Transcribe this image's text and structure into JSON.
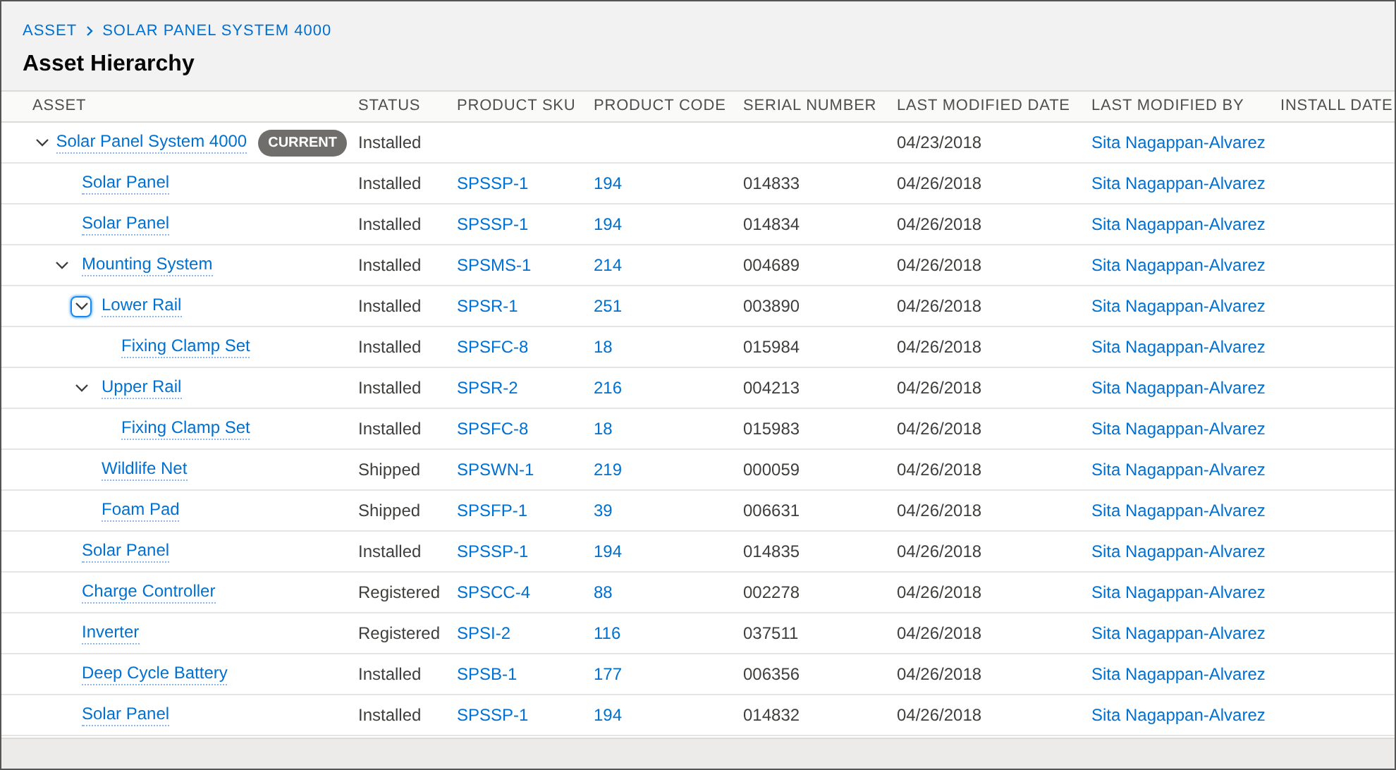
{
  "breadcrumb": [
    {
      "label": "ASSET"
    },
    {
      "label": "SOLAR PANEL SYSTEM 4000"
    }
  ],
  "title": "Asset Hierarchy",
  "table": {
    "columns": [
      "ASSET",
      "STATUS",
      "PRODUCT SKU",
      "PRODUCT CODE",
      "SERIAL NUMBER",
      "LAST MODIFIED DATE",
      "LAST MODIFIED BY",
      "INSTALL DATE"
    ],
    "rows": [
      {
        "name": "Solar Panel System 4000",
        "badge": "CURRENT",
        "status": "Installed",
        "sku": "",
        "code": "",
        "serial": "",
        "modified": "04/23/2018",
        "modified_by": "Sita Nagappan-Alvarez",
        "expanded": true,
        "focused": false,
        "children": [
          {
            "name": "Solar Panel",
            "status": "Installed",
            "sku": "SPSSP-1",
            "code": "194",
            "serial": "014833",
            "modified": "04/26/2018",
            "modified_by": "Sita Nagappan-Alvarez"
          },
          {
            "name": "Solar Panel",
            "status": "Installed",
            "sku": "SPSSP-1",
            "code": "194",
            "serial": "014834",
            "modified": "04/26/2018",
            "modified_by": "Sita Nagappan-Alvarez"
          },
          {
            "name": "Mounting System",
            "status": "Installed",
            "sku": "SPSMS-1",
            "code": "214",
            "serial": "004689",
            "modified": "04/26/2018",
            "modified_by": "Sita Nagappan-Alvarez",
            "expanded": true,
            "focused": false,
            "children": [
              {
                "name": "Lower Rail",
                "status": "Installed",
                "sku": "SPSR-1",
                "code": "251",
                "serial": "003890",
                "modified": "04/26/2018",
                "modified_by": "Sita Nagappan-Alvarez",
                "expanded": true,
                "focused": true,
                "children": [
                  {
                    "name": "Fixing Clamp Set",
                    "status": "Installed",
                    "sku": "SPSFC-8",
                    "code": "18",
                    "serial": "015984",
                    "modified": "04/26/2018",
                    "modified_by": "Sita Nagappan-Alvarez"
                  }
                ]
              },
              {
                "name": "Upper Rail",
                "status": "Installed",
                "sku": "SPSR-2",
                "code": "216",
                "serial": "004213",
                "modified": "04/26/2018",
                "modified_by": "Sita Nagappan-Alvarez",
                "expanded": true,
                "focused": false,
                "children": [
                  {
                    "name": "Fixing Clamp Set",
                    "status": "Installed",
                    "sku": "SPSFC-8",
                    "code": "18",
                    "serial": "015983",
                    "modified": "04/26/2018",
                    "modified_by": "Sita Nagappan-Alvarez"
                  }
                ]
              },
              {
                "name": "Wildlife Net",
                "status": "Shipped",
                "sku": "SPSWN-1",
                "code": "219",
                "serial": "000059",
                "modified": "04/26/2018",
                "modified_by": "Sita Nagappan-Alvarez"
              },
              {
                "name": "Foam Pad",
                "status": "Shipped",
                "sku": "SPSFP-1",
                "code": "39",
                "serial": "006631",
                "modified": "04/26/2018",
                "modified_by": "Sita Nagappan-Alvarez"
              }
            ]
          },
          {
            "name": "Solar Panel",
            "status": "Installed",
            "sku": "SPSSP-1",
            "code": "194",
            "serial": "014835",
            "modified": "04/26/2018",
            "modified_by": "Sita Nagappan-Alvarez"
          },
          {
            "name": "Charge Controller",
            "status": "Registered",
            "sku": "SPSCC-4",
            "code": "88",
            "serial": "002278",
            "modified": "04/26/2018",
            "modified_by": "Sita Nagappan-Alvarez"
          },
          {
            "name": "Inverter",
            "status": "Registered",
            "sku": "SPSI-2",
            "code": "116",
            "serial": "037511",
            "modified": "04/26/2018",
            "modified_by": "Sita Nagappan-Alvarez"
          },
          {
            "name": "Deep Cycle Battery",
            "status": "Installed",
            "sku": "SPSB-1",
            "code": "177",
            "serial": "006356",
            "modified": "04/26/2018",
            "modified_by": "Sita Nagappan-Alvarez"
          },
          {
            "name": "Solar Panel",
            "status": "Installed",
            "sku": "SPSSP-1",
            "code": "194",
            "serial": "014832",
            "modified": "04/26/2018",
            "modified_by": "Sita Nagappan-Alvarez"
          }
        ]
      }
    ]
  }
}
